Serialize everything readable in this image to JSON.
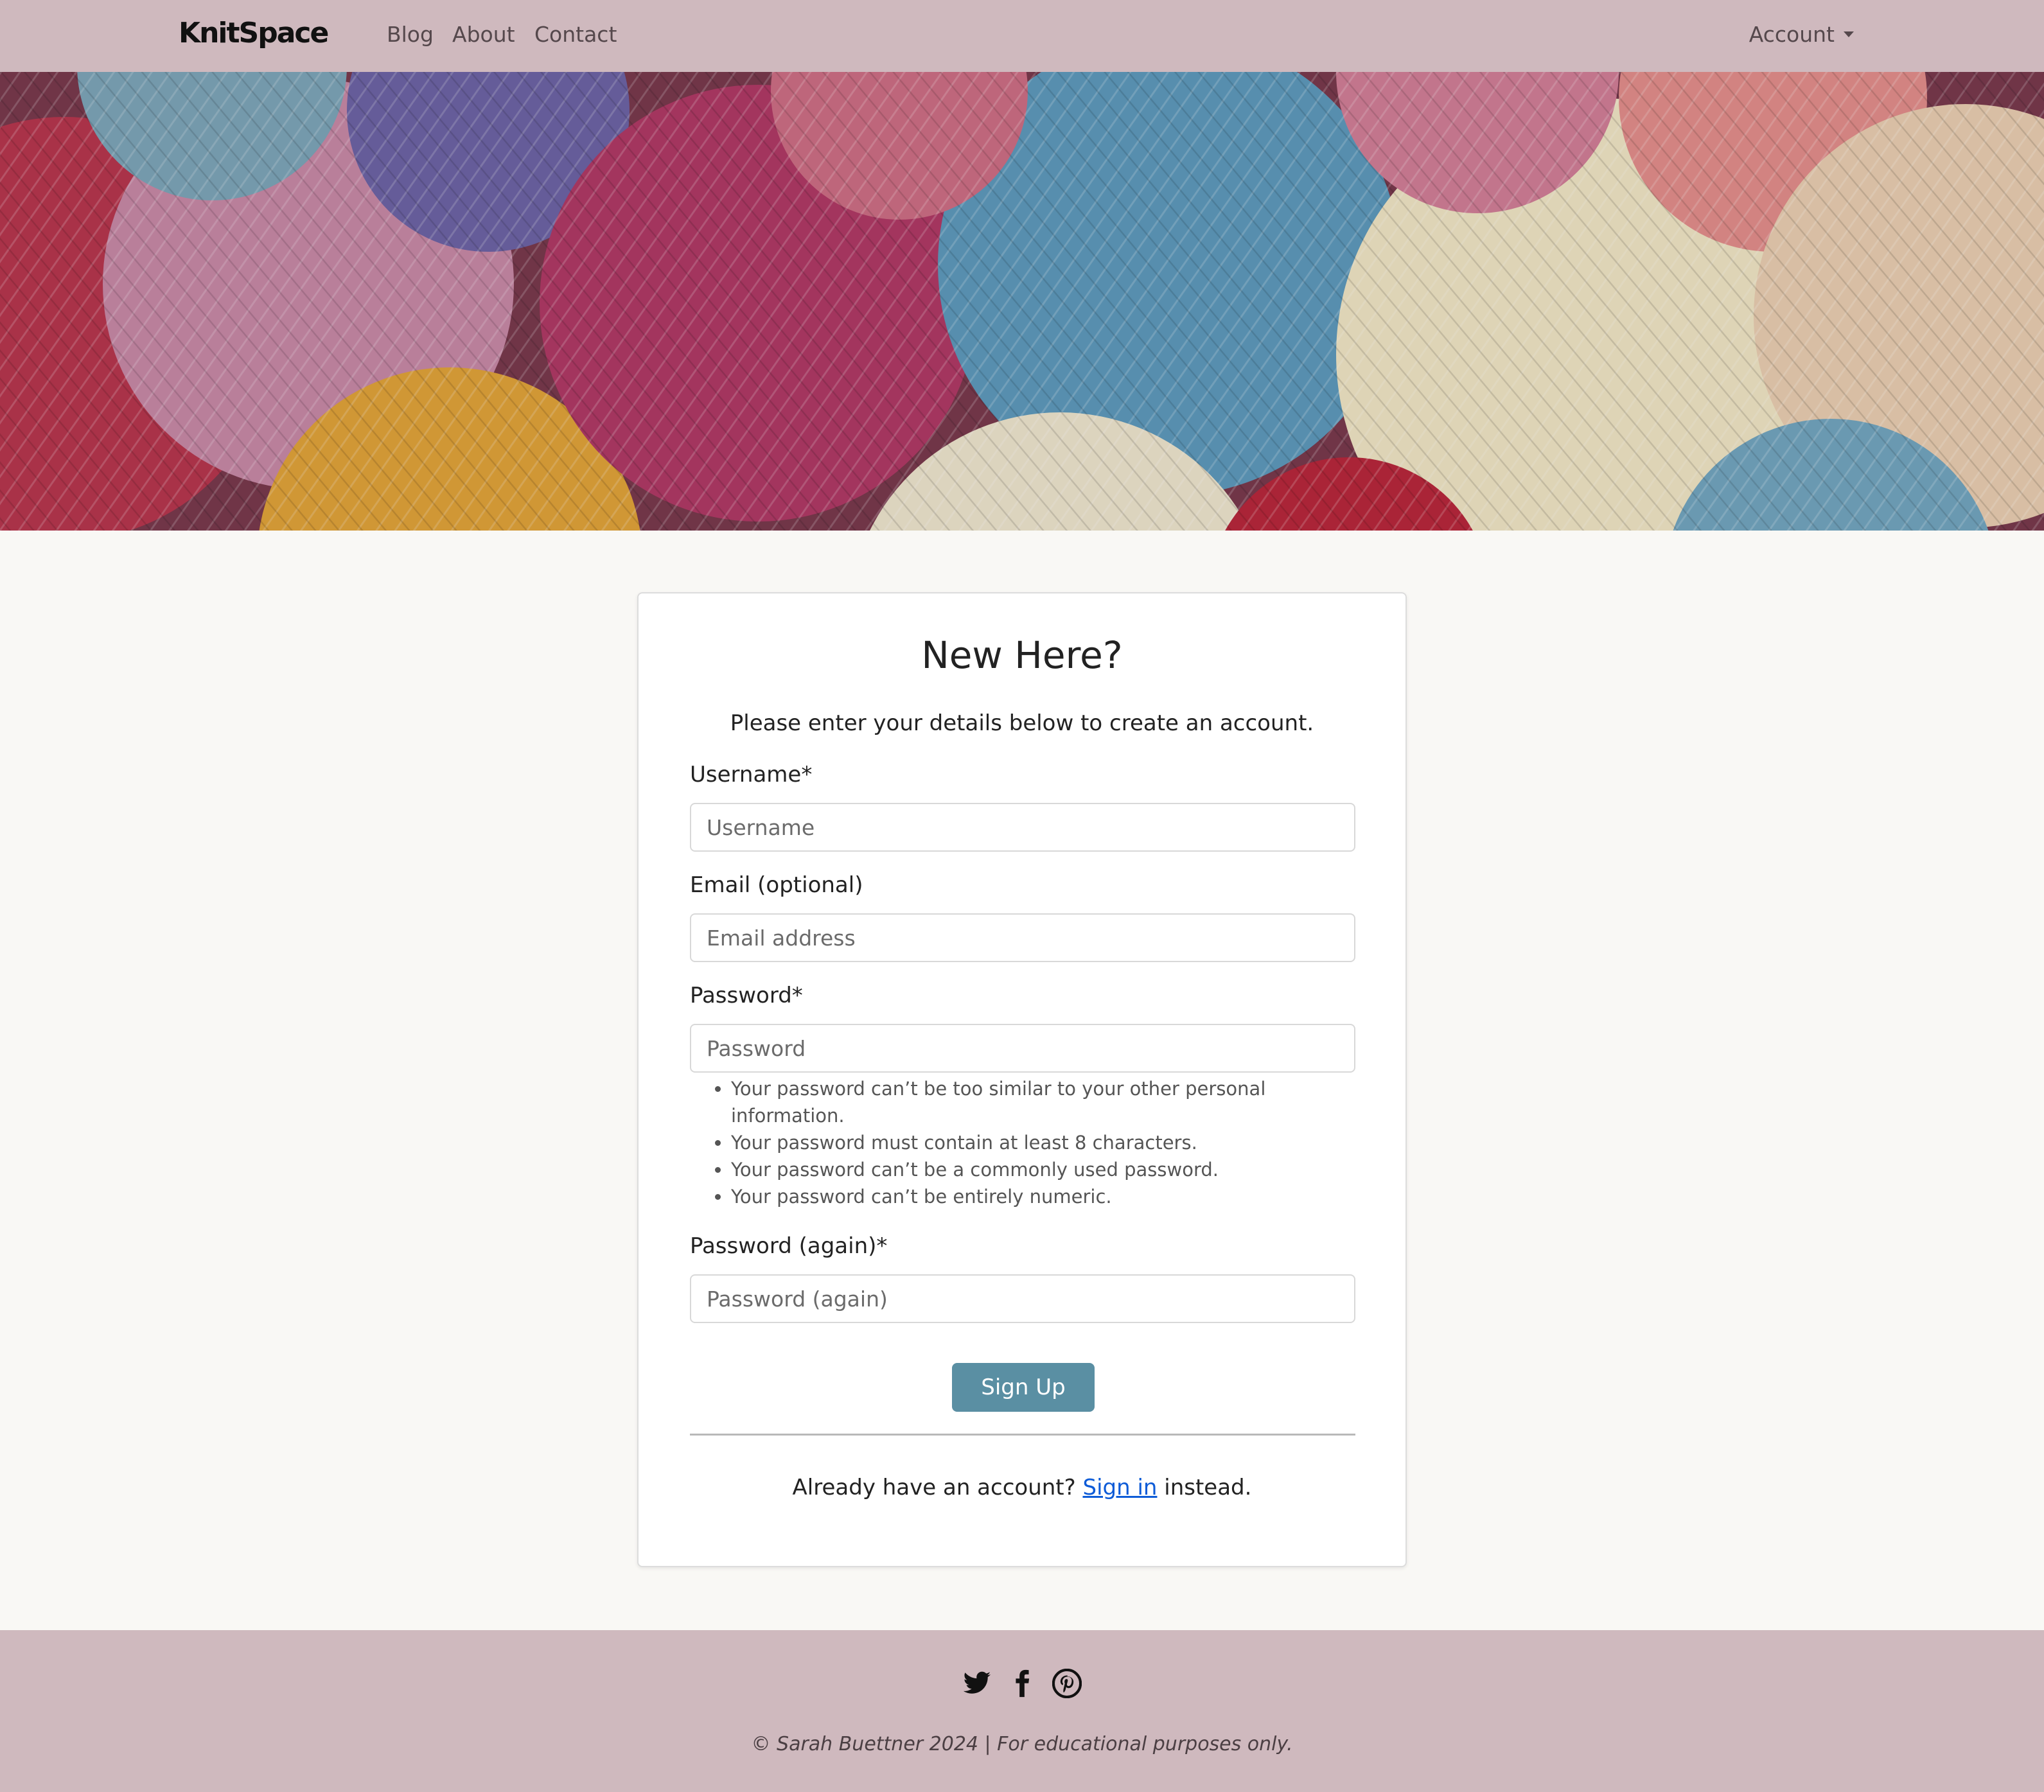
{
  "nav": {
    "brand": "KnitSpace",
    "links": [
      "Blog",
      "About",
      "Contact"
    ],
    "account": "Account"
  },
  "hero": {
    "image": "colorful-yarn-balls-photo"
  },
  "signup": {
    "title": "New Here?",
    "intro": "Please enter your details below to create an account.",
    "username_label": "Username*",
    "username_placeholder": "Username",
    "email_label": "Email (optional)",
    "email_placeholder": "Email address",
    "password_label": "Password*",
    "password_placeholder": "Password",
    "password_help": [
      "Your password can’t be too similar to your other personal information.",
      "Your password must contain at least 8 characters.",
      "Your password can’t be a commonly used password.",
      "Your password can’t be entirely numeric."
    ],
    "password2_label": "Password (again)*",
    "password2_placeholder": "Password (again)",
    "submit": "Sign Up",
    "signin_prefix": "Already have an account?",
    "signin_link": "Sign in",
    "signin_suffix": "instead."
  },
  "footer": {
    "social_icons": [
      "twitter-icon",
      "facebook-icon",
      "pinterest-icon"
    ],
    "copyright": "© Sarah Buettner 2024 | For educational purposes only."
  },
  "colors": {
    "navbar": "#cfb9be",
    "page_background": "#f9f8f5",
    "button": "#5a8fa3",
    "link": "#0d5bd7"
  }
}
